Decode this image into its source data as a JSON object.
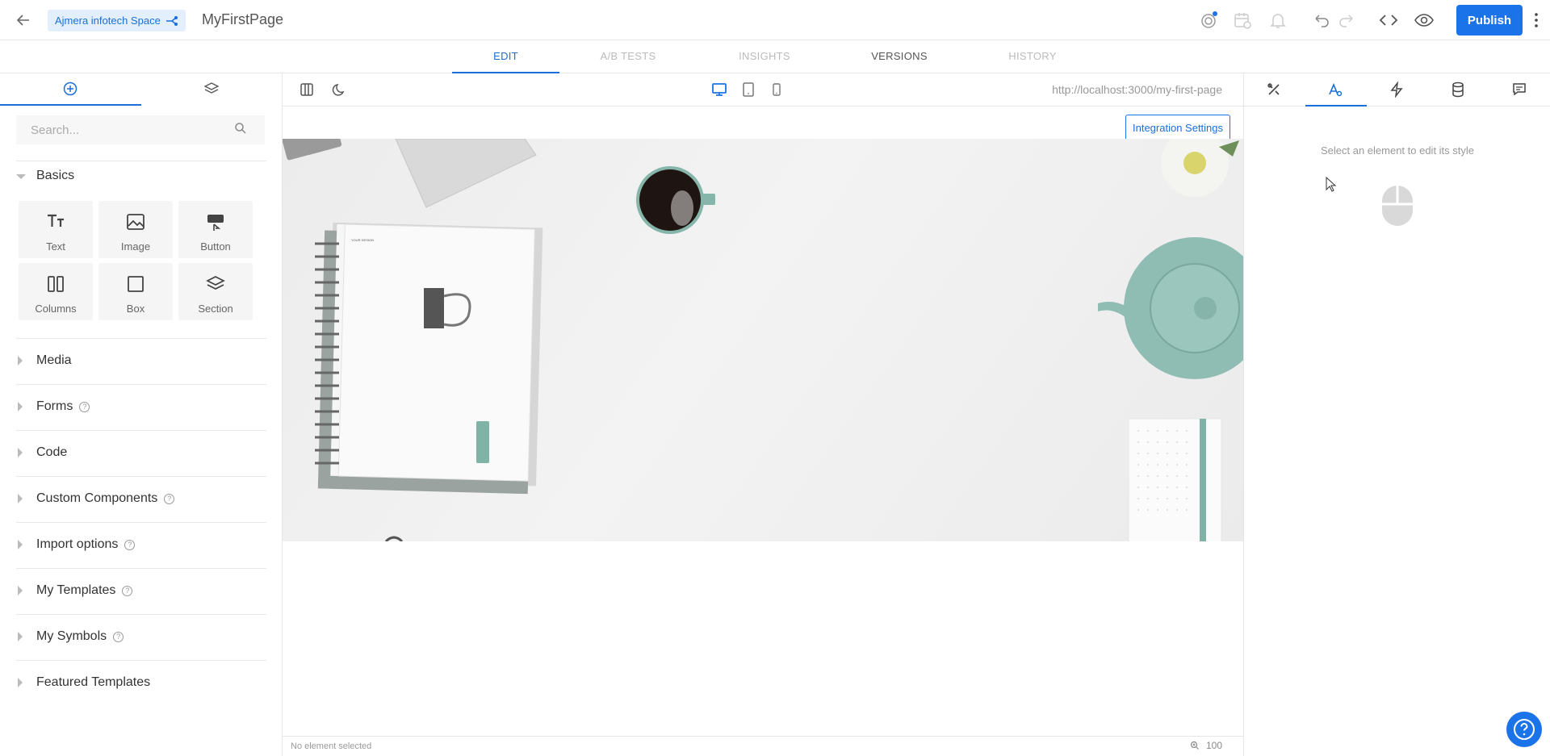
{
  "header": {
    "space_label": "Ajmera infotech Space",
    "page_name": "MyFirstPage",
    "publish_label": "Publish"
  },
  "mode_tabs": [
    {
      "label": "EDIT",
      "state": "active"
    },
    {
      "label": "A/B TESTS",
      "state": "disabled"
    },
    {
      "label": "INSIGHTS",
      "state": "disabled"
    },
    {
      "label": "VERSIONS",
      "state": "normal"
    },
    {
      "label": "HISTORY",
      "state": "disabled"
    }
  ],
  "left_panel": {
    "search_placeholder": "Search...",
    "basics_title": "Basics",
    "blocks": [
      {
        "label": "Text",
        "icon": "text-icon"
      },
      {
        "label": "Image",
        "icon": "image-icon"
      },
      {
        "label": "Button",
        "icon": "button-icon"
      },
      {
        "label": "Columns",
        "icon": "columns-icon"
      },
      {
        "label": "Box",
        "icon": "box-icon"
      },
      {
        "label": "Section",
        "icon": "section-icon"
      }
    ],
    "sections": [
      {
        "label": "Media",
        "help": false
      },
      {
        "label": "Forms",
        "help": true
      },
      {
        "label": "Code",
        "help": false
      },
      {
        "label": "Custom Components",
        "help": true
      },
      {
        "label": "Import options",
        "help": true
      },
      {
        "label": "My Templates",
        "help": true
      },
      {
        "label": "My Symbols",
        "help": true
      },
      {
        "label": "Featured Templates",
        "help": false
      }
    ]
  },
  "canvas": {
    "url": "http://localhost:3000/my-first-page",
    "integration_button": "Integration Settings",
    "status_text": "No element selected",
    "zoom_value": "100",
    "notebook_label": "YOUR DESIGN"
  },
  "right_panel": {
    "hint": "Select an element to edit its style"
  },
  "colors": {
    "accent": "#1a73e8",
    "space_bg": "#e3effd"
  }
}
